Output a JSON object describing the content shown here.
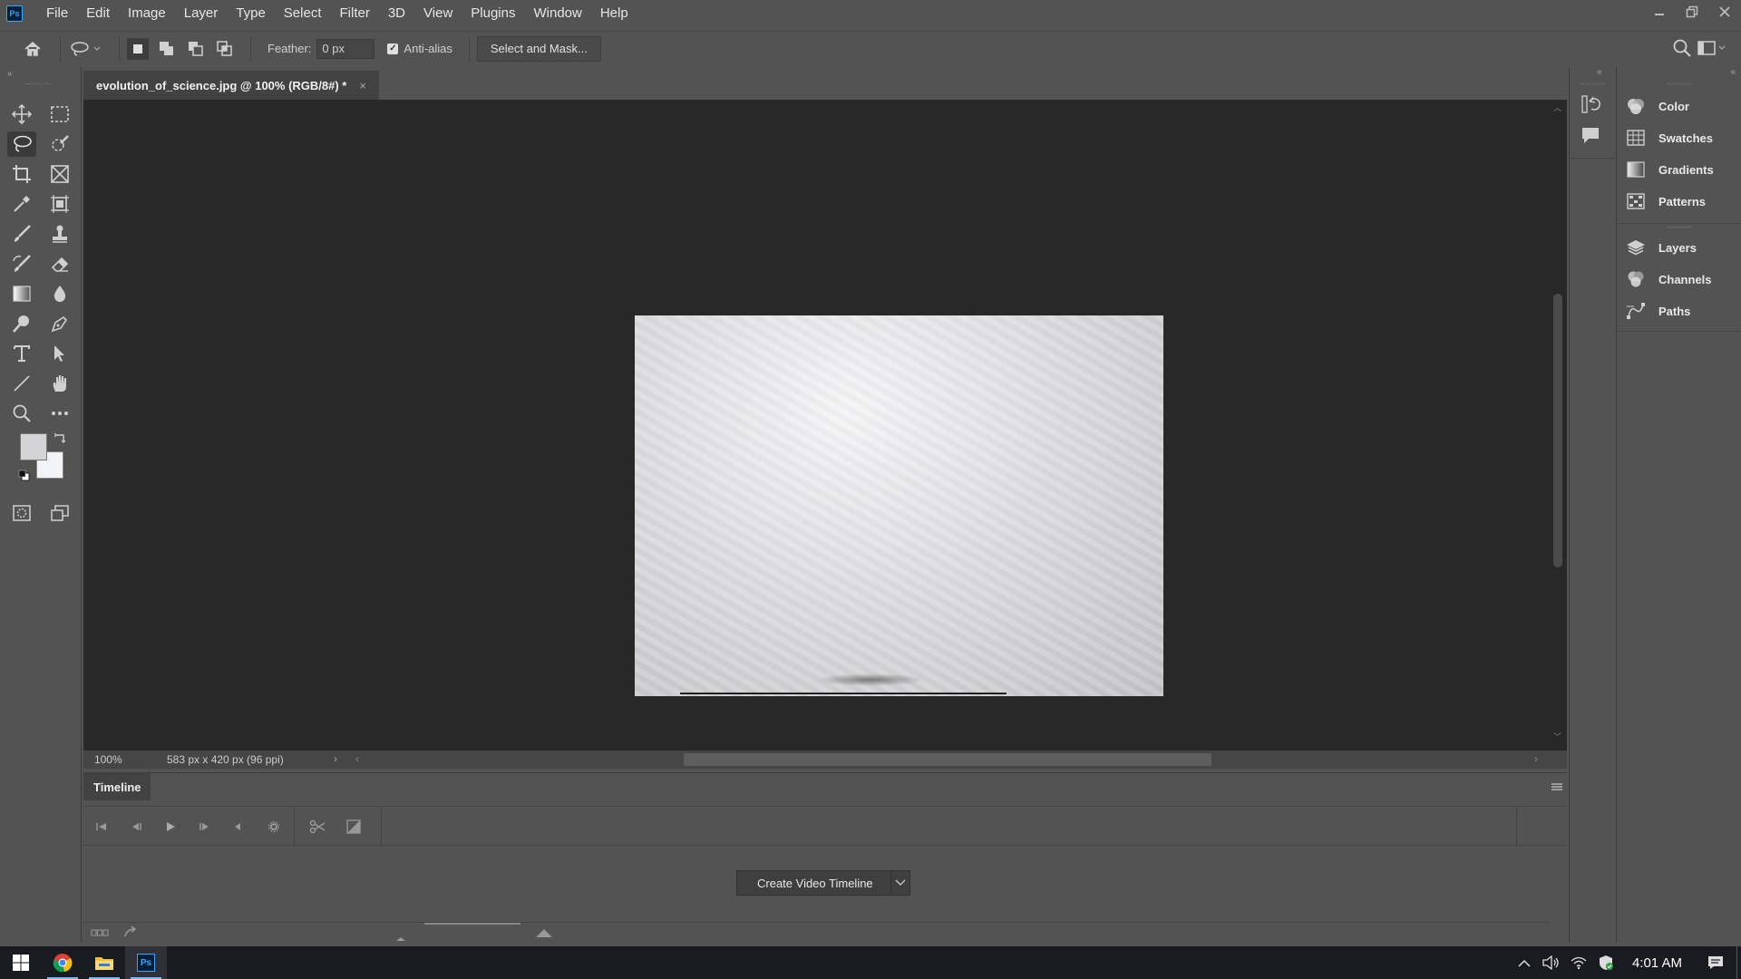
{
  "app": {
    "logo_text": "Ps",
    "menu": [
      "File",
      "Edit",
      "Image",
      "Layer",
      "Type",
      "Select",
      "Filter",
      "3D",
      "View",
      "Plugins",
      "Window",
      "Help"
    ]
  },
  "options_bar": {
    "feather_label": "Feather:",
    "feather_value": "0 px",
    "anti_alias_label": "Anti-alias",
    "anti_alias_checked": true,
    "select_mask_label": "Select and Mask..."
  },
  "document": {
    "tab_title": "evolution_of_science.jpg @ 100% (RGB/8#) *",
    "close_glyph": "×"
  },
  "status": {
    "zoom": "100%",
    "doc_info": "583 px x 420 px (96 ppi)"
  },
  "timeline": {
    "tab_label": "Timeline",
    "create_button_label": "Create Video Timeline"
  },
  "right_panels": {
    "group1": [
      "Color",
      "Swatches",
      "Gradients",
      "Patterns"
    ],
    "group2": [
      "Layers",
      "Channels",
      "Paths"
    ]
  },
  "colors": {
    "foreground": "#d4d4d6",
    "background": "#f2f4f8",
    "accent": "#31a8ff"
  },
  "taskbar": {
    "time": "4:01 AM"
  }
}
